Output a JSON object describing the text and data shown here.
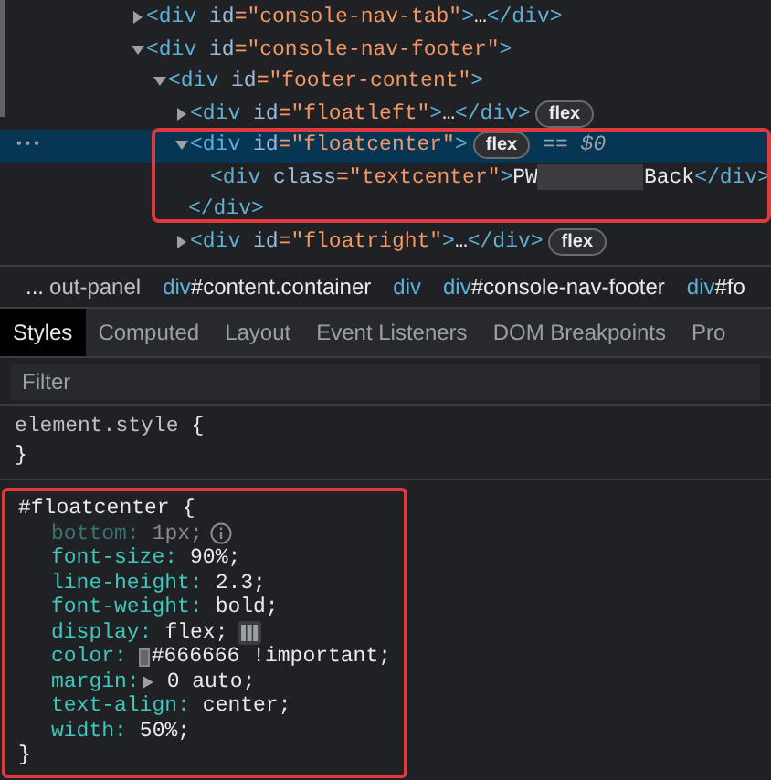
{
  "dom_tree": {
    "nodes": [
      {
        "tag": "<div",
        "attr": " id",
        "value": "=\"console-nav-tab\"",
        "end": ">",
        "expanded": false,
        "ellipsis": "…",
        "close": "</div>",
        "selected": false
      },
      {
        "tag": "<div",
        "attr": " id",
        "value": "=\"console-nav-footer\"",
        "end": ">",
        "expanded": true,
        "selected": false,
        "children": [
          {
            "tag": "<div",
            "attr": " id",
            "value": "=\"footer-content\"",
            "end": ">",
            "expanded": true,
            "selected": false,
            "children": [
              {
                "tag": "<div",
                "attr": " id",
                "value": "=\"floatleft\"",
                "end": ">",
                "expanded": false,
                "ellipsis": "…",
                "close": "</div>",
                "badge": "flex",
                "selected": false
              },
              {
                "tag": "<div",
                "attr": " id",
                "value": "=\"floatcenter\"",
                "end": ">",
                "expanded": true,
                "badge": "flex",
                "marker": "== $0",
                "selected": true,
                "highlighted": true,
                "close_row": "</div>",
                "children": [
                  {
                    "tag": "<div",
                    "attr": " class",
                    "value": "=\"textcenter\"",
                    "end": ">",
                    "text_before": "PW",
                    "redacted": true,
                    "text_after": "Back",
                    "close": "</div>",
                    "selected": false
                  }
                ]
              },
              {
                "tag": "<div",
                "attr": " id",
                "value": "=\"floatright\"",
                "end": ">",
                "expanded": false,
                "ellipsis": "…",
                "close": "</div>",
                "badge": "flex",
                "selected": false
              }
            ]
          }
        ]
      }
    ],
    "row_menu": "•••"
  },
  "breadcrumbs": {
    "more": "...",
    "items": [
      {
        "rest": "out-panel"
      },
      {
        "tag": "div",
        "rest": "#content.container"
      },
      {
        "tag": "div"
      },
      {
        "tag": "div",
        "rest": "#console-nav-footer"
      },
      {
        "tag": "div",
        "rest": "#fo"
      }
    ]
  },
  "tabs": [
    {
      "label": "Styles",
      "selected": true
    },
    {
      "label": "Computed",
      "selected": false
    },
    {
      "label": "Layout",
      "selected": false
    },
    {
      "label": "Event Listeners",
      "selected": false
    },
    {
      "label": "DOM Breakpoints",
      "selected": false
    },
    {
      "label": "Pro",
      "selected": false
    }
  ],
  "filter": {
    "placeholder": "Filter"
  },
  "element_style": {
    "selector": "element.style",
    "open": "{",
    "close": "}"
  },
  "rule": {
    "selector": "#floatcenter",
    "open": "{",
    "close": "}",
    "highlighted": true,
    "properties": [
      {
        "name": "bottom:",
        "value": "1px;",
        "kind": "info",
        "disabled": true
      },
      {
        "name": "font-size:",
        "value": "90%;",
        "kind": "plain",
        "disabled": false
      },
      {
        "name": "line-height:",
        "value": "2.3;",
        "kind": "plain",
        "disabled": false
      },
      {
        "name": "font-weight:",
        "value": "bold;",
        "kind": "plain",
        "disabled": false
      },
      {
        "name": "display:",
        "value": "flex;",
        "kind": "flex",
        "disabled": false
      },
      {
        "name": "color:",
        "value": "#666666 !important;",
        "kind": "swatch",
        "color": "#666666",
        "disabled": false
      },
      {
        "name": "margin:",
        "value": "0 auto;",
        "kind": "expand",
        "disabled": false
      },
      {
        "name": "text-align:",
        "value": "center;",
        "kind": "plain",
        "disabled": false
      },
      {
        "name": "width:",
        "value": "50%;",
        "kind": "plain",
        "disabled": false
      }
    ]
  }
}
